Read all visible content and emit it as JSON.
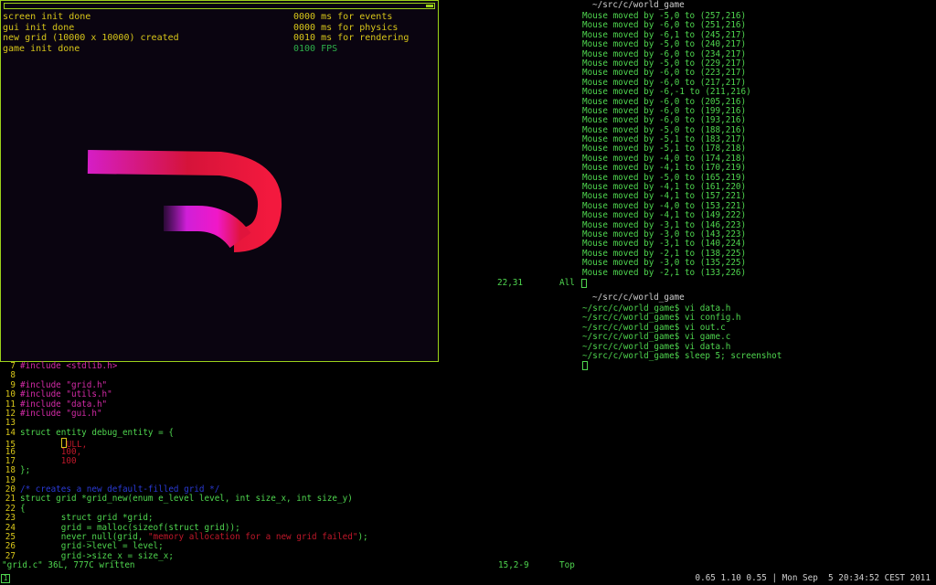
{
  "game": {
    "stats_left": [
      "screen init done",
      "gui init done",
      "new grid (10000 x 10000) created",
      "game init done"
    ],
    "stats_right": [
      "0000 ms for events",
      "0000 ms for physics",
      "0010 ms for rendering",
      "0100 FPS"
    ]
  },
  "terminal_top": {
    "title": "~/src/c/world_game",
    "lines": [
      "Mouse moved by -5,0 to (257,216)",
      "Mouse moved by -6,0 to (251,216)",
      "Mouse moved by -6,1 to (245,217)",
      "Mouse moved by -5,0 to (240,217)",
      "Mouse moved by -6,0 to (234,217)",
      "Mouse moved by -5,0 to (229,217)",
      "Mouse moved by -6,0 to (223,217)",
      "Mouse moved by -6,0 to (217,217)",
      "Mouse moved by -6,-1 to (211,216)",
      "Mouse moved by -6,0 to (205,216)",
      "Mouse moved by -6,0 to (199,216)",
      "Mouse moved by -6,0 to (193,216)",
      "Mouse moved by -5,0 to (188,216)",
      "Mouse moved by -5,1 to (183,217)",
      "Mouse moved by -5,1 to (178,218)",
      "Mouse moved by -4,0 to (174,218)",
      "Mouse moved by -4,1 to (170,219)",
      "Mouse moved by -5,0 to (165,219)",
      "Mouse moved by -4,1 to (161,220)",
      "Mouse moved by -4,1 to (157,221)",
      "Mouse moved by -4,0 to (153,221)",
      "Mouse moved by -4,1 to (149,222)",
      "Mouse moved by -3,1 to (146,223)",
      "Mouse moved by -3,0 to (143,223)",
      "Mouse moved by -3,1 to (140,224)",
      "Mouse moved by -2,1 to (138,225)",
      "Mouse moved by -3,0 to (135,225)",
      "Mouse moved by -2,1 to (133,226)"
    ],
    "status_pos": "22,31",
    "status_all": "All"
  },
  "terminal_shell": {
    "title": "~/src/c/world_game",
    "lines": [
      "~/src/c/world_game$ vi data.h",
      "~/src/c/world_game$ vi config.h",
      "~/src/c/world_game$ vi out.c",
      "~/src/c/world_game$ vi game.c",
      "~/src/c/world_game$ vi data.h",
      "~/src/c/world_game$ sleep 5; screenshot"
    ]
  },
  "vim": {
    "lines": [
      {
        "n": "7",
        "t": "pp",
        "text": "#include <stdlib.h>"
      },
      {
        "n": "8",
        "t": "",
        "text": ""
      },
      {
        "n": "9",
        "t": "pp",
        "text": "#include \"grid.h\""
      },
      {
        "n": "10",
        "t": "pp",
        "text": "#include \"utils.h\""
      },
      {
        "n": "11",
        "t": "pp",
        "text": "#include \"data.h\""
      },
      {
        "n": "12",
        "t": "pp",
        "text": "#include \"gui.h\""
      },
      {
        "n": "13",
        "t": "",
        "text": ""
      },
      {
        "n": "14",
        "t": "kw",
        "text": "struct entity debug_entity = {"
      },
      {
        "n": "15",
        "t": "cursor",
        "text": "ULL,"
      },
      {
        "n": "16",
        "t": "num",
        "text": "        100,"
      },
      {
        "n": "17",
        "t": "num",
        "text": "        100"
      },
      {
        "n": "18",
        "t": "kw",
        "text": "};"
      },
      {
        "n": "19",
        "t": "",
        "text": ""
      },
      {
        "n": "20",
        "t": "cm",
        "text": "/* creates a new default-filled grid */"
      },
      {
        "n": "21",
        "t": "kw",
        "text": "struct grid *grid_new(enum e_level level, int size_x, int size_y)"
      },
      {
        "n": "22",
        "t": "kw",
        "text": "{"
      },
      {
        "n": "23",
        "t": "kw",
        "text": "        struct grid *grid;"
      },
      {
        "n": "24",
        "t": "kw",
        "text": "        grid = malloc(sizeof(struct grid));"
      },
      {
        "n": "25",
        "t": "mixed",
        "text": "        never_null(grid, ",
        "str": "\"memory allocation for a new grid failed\"",
        "tail": ");"
      },
      {
        "n": "26",
        "t": "kw",
        "text": "        grid->level = level;"
      },
      {
        "n": "27",
        "t": "kw",
        "text": "        grid->size_x = size_x;"
      }
    ],
    "status_msg": "\"grid.c\" 36L, 777C written",
    "status_pos": "15,2-9",
    "status_scroll": "Top"
  },
  "bottombar": {
    "tag": "1",
    "clock": "0.65 1.10 0.55 | Mon Sep  5 20:34:52 CEST 2011"
  },
  "colors": {
    "terminal_green": "#4fd64f",
    "stats_yellow": "#d8c61a",
    "worm_magenta": "#e01fd0",
    "worm_red": "#e0143c"
  }
}
